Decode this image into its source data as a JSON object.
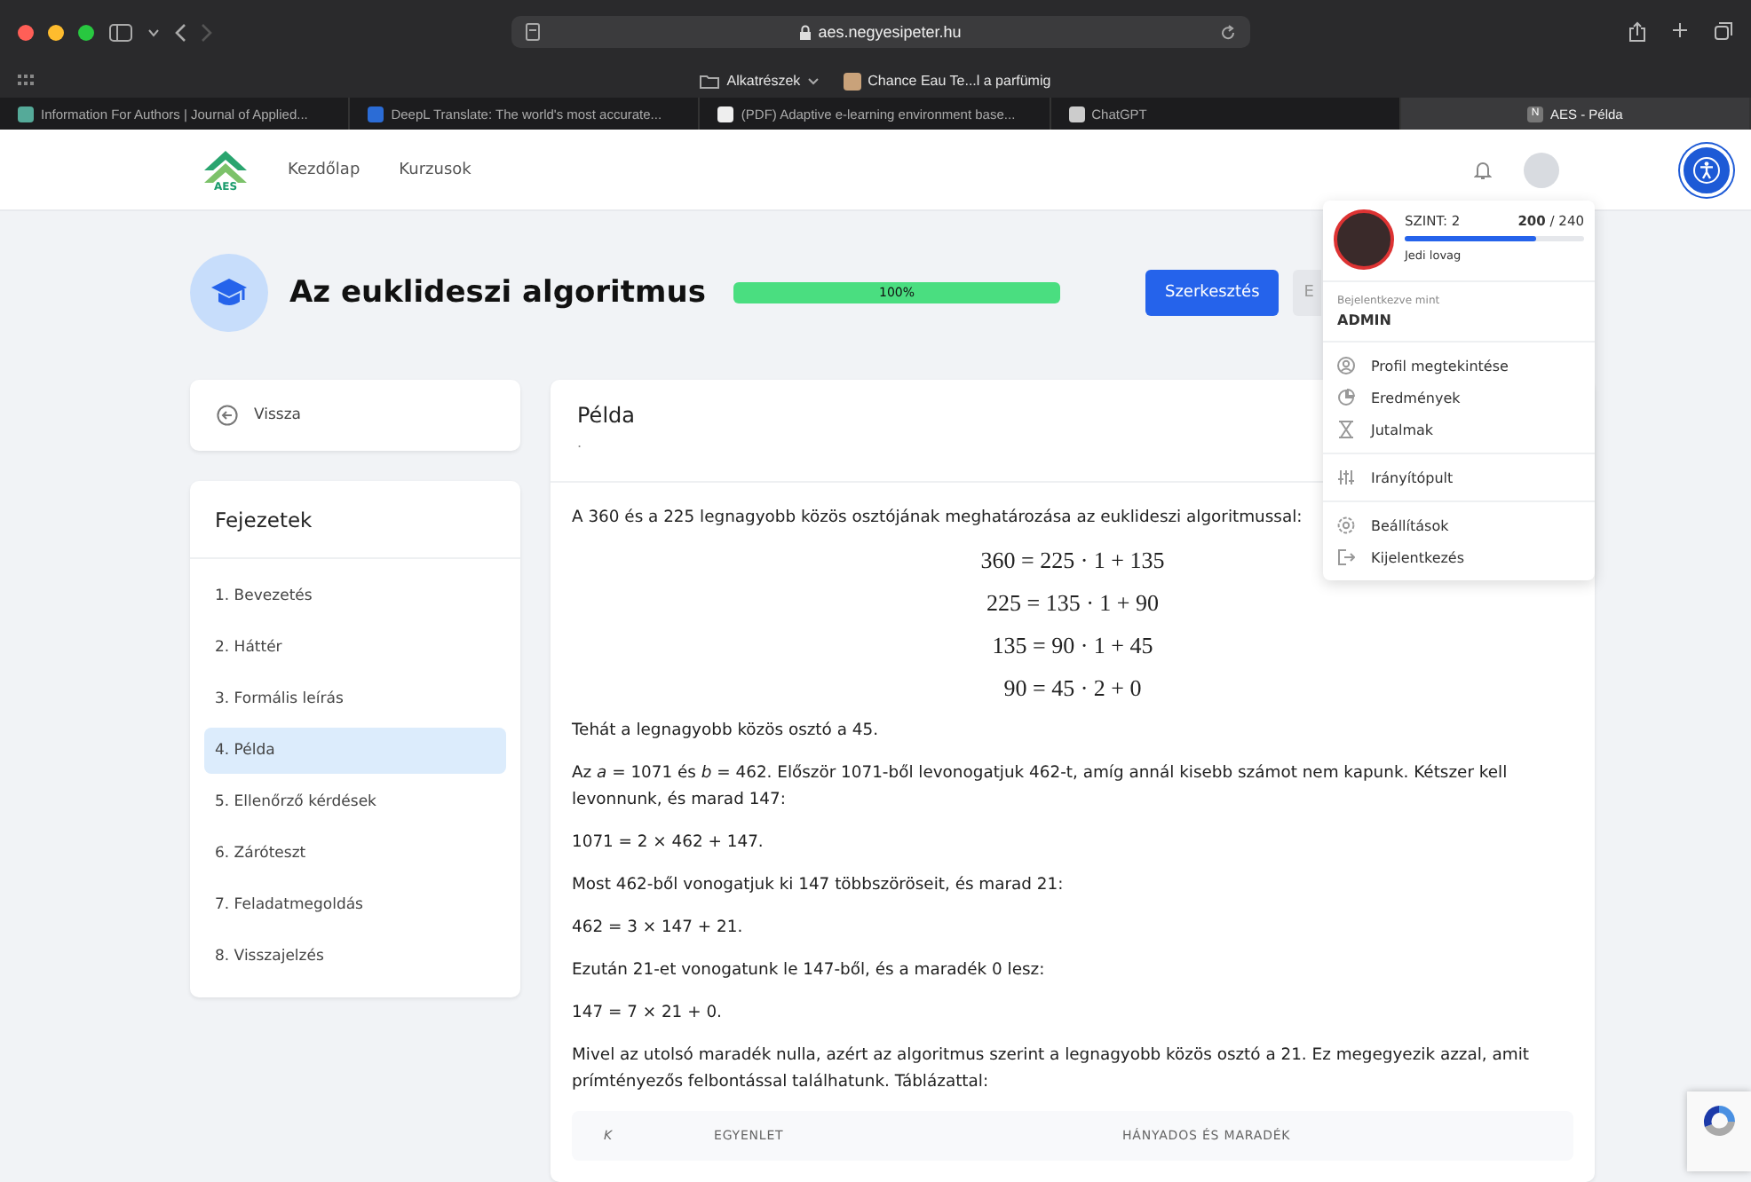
{
  "browser": {
    "url": "aes.negyesipeter.hu",
    "bookmarks": [
      {
        "label": "Alkatrészek",
        "kind": "folder"
      },
      {
        "label": "Chance Eau Te...l a parfümig",
        "kind": "page"
      }
    ],
    "tabs": [
      {
        "label": "Information For Authors | Journal of Applied...",
        "selected": false
      },
      {
        "label": "DeepL Translate: The world's most accurate...",
        "selected": false
      },
      {
        "label": "(PDF) Adaptive e-learning environment base...",
        "selected": false
      },
      {
        "label": "ChatGPT",
        "selected": false
      },
      {
        "label": "AES - Példa",
        "selected": true,
        "favicon": "N"
      }
    ]
  },
  "nav": {
    "logo": "AES",
    "links": [
      "Kezdőlap",
      "Kurzusok"
    ]
  },
  "course": {
    "title": "Az euklideszi algoritmus",
    "progress": {
      "level": 1,
      "reading": "100%"
    },
    "buttons": [
      {
        "label": "Szerkesztés",
        "kind": "primary"
      },
      {
        "label": "E",
        "kind": "secondary"
      }
    ]
  },
  "back": "Vissza",
  "chapters": {
    "title": "Fejezetek",
    "items": [
      {
        "label": "1. Bevezetés",
        "selected": false
      },
      {
        "label": "2. Háttér",
        "selected": false
      },
      {
        "label": "3. Formális leírás",
        "selected": false
      },
      {
        "label": "4. Példa",
        "selected": true
      },
      {
        "label": "5. Ellenőrző kérdések",
        "selected": false
      },
      {
        "label": "6. Záróteszt",
        "selected": false
      },
      {
        "label": "7. Feladatmegoldás",
        "selected": false
      },
      {
        "label": "8. Visszajelzés",
        "selected": false
      }
    ]
  },
  "lesson": {
    "title": "Példa",
    "subtitle": ".",
    "blocks": [
      {
        "kind": "text",
        "text": "A 360 és a 225 legnagyobb közös osztójának meghatározása az euklideszi algoritmussal:"
      },
      {
        "kind": "math",
        "text": "360 = 225 · 1 + 135"
      },
      {
        "kind": "math",
        "text": "225 = 135 · 1 + 90"
      },
      {
        "kind": "math",
        "text": "135 = 90 · 1 + 45"
      },
      {
        "kind": "math",
        "text": "90 = 45 · 2 + 0"
      },
      {
        "kind": "text",
        "text": "Tehát a legnagyobb közös osztó a 45."
      },
      {
        "kind": "text",
        "text": "Az *a* = 1071 és *b* = 462. Először 1071-ből levonogatjuk 462-t, amíg annál kisebb számot nem kapunk. Kétszer kell levonnunk, és marad 147:"
      },
      {
        "kind": "text",
        "text": "1071 = 2 × 462 + 147."
      },
      {
        "kind": "text",
        "text": "Most 462-ből vonogatjuk ki 147 többszöröseit, és marad 21:"
      },
      {
        "kind": "text",
        "text": "462 = 3 × 147 + 21."
      },
      {
        "kind": "text",
        "text": "Ezután 21-et vonogatunk le 147-ből, és a maradék 0 lesz:"
      },
      {
        "kind": "text",
        "text": "147 = 7 × 21 + 0."
      },
      {
        "kind": "text",
        "text": "Mivel az utolsó maradék nulla, azért az algoritmus szerint a legnagyobb közös osztó a 21. Ez megegyezik azzal, amit prímtényezős felbontással találhatunk. Táblázattal:"
      }
    ],
    "table": {
      "columns": [
        {
          "label": "K",
          "italic": true
        },
        {
          "label": "EGYENLET",
          "italic": false
        },
        {
          "label": "HÁNYADOS ÉS MARADÉK",
          "italic": false
        }
      ]
    }
  },
  "user_menu": {
    "level_label": "SZINT: 2",
    "points": "200",
    "max": "/ 240",
    "xp": {
      "level": 0.73
    },
    "rank": "Jedi lovag",
    "signed_in_label": "Bejelentkezve mint",
    "username": "ADMIN",
    "groups": [
      [
        {
          "label": "Profil megtekintése"
        },
        {
          "label": "Eredmények"
        },
        {
          "label": "Jutalmak"
        }
      ],
      [
        {
          "label": "Irányítópult"
        }
      ],
      [
        {
          "label": "Beállítások"
        },
        {
          "label": "Kijelentkezés"
        }
      ]
    ]
  }
}
